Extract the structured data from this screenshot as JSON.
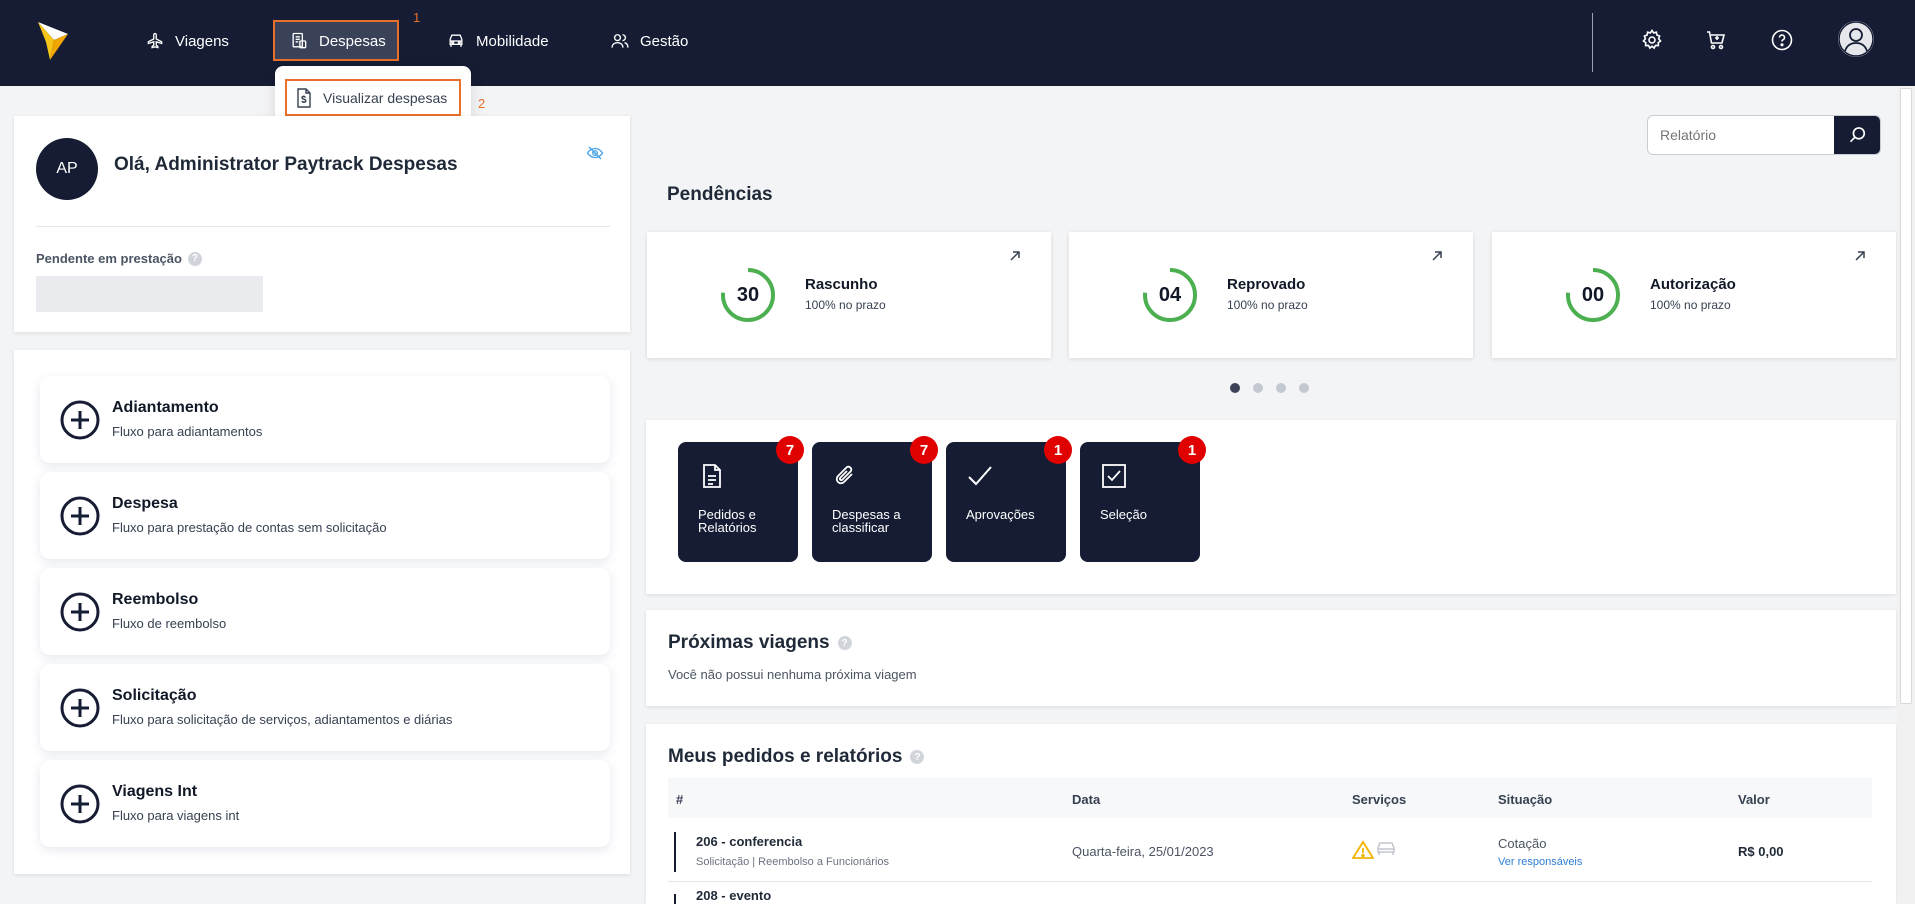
{
  "nav": {
    "items": [
      {
        "label": "Viagens",
        "icon": "airplane-icon"
      },
      {
        "label": "Despesas",
        "icon": "receipt-icon"
      },
      {
        "label": "Mobilidade",
        "icon": "car-icon"
      },
      {
        "label": "Gestão",
        "icon": "users-icon"
      }
    ],
    "step1": "1",
    "step2": "2",
    "right_icons": [
      "gear-icon",
      "cart-icon",
      "help-icon",
      "user-avatar-icon"
    ]
  },
  "dropdown": {
    "item": "Visualizar despesas",
    "icon": "dollar-document-icon"
  },
  "profile": {
    "initials": "AP",
    "greeting": "Olá, Administrator Paytrack Despesas",
    "pending_label": "Pendente em prestação",
    "help": "?"
  },
  "flows": [
    {
      "title": "Adiantamento",
      "subtitle": "Fluxo para adiantamentos"
    },
    {
      "title": "Despesa",
      "subtitle": "Fluxo para prestação de contas sem solicitação"
    },
    {
      "title": "Reembolso",
      "subtitle": "Fluxo de reembolso"
    },
    {
      "title": "Solicitação",
      "subtitle": "Fluxo para solicitação de serviços, adiantamentos e diárias"
    },
    {
      "title": "Viagens Int",
      "subtitle": "Fluxo para viagens int"
    }
  ],
  "search": {
    "placeholder": "Relatório"
  },
  "pendencias": {
    "title": "Pendências",
    "cards": [
      {
        "count": "30",
        "label": "Rascunho",
        "sub": "100% no prazo",
        "progress": 1.0
      },
      {
        "count": "04",
        "label": "Reprovado",
        "sub": "100% no prazo",
        "progress": 1.0
      },
      {
        "count": "00",
        "label": "Autorização",
        "sub": "100% no prazo",
        "progress": 1.0
      }
    ],
    "carousel": {
      "pages": 4,
      "active": 1
    }
  },
  "tiles": [
    {
      "label_line1": "Pedidos e",
      "label_line2": "Relatórios",
      "badge": "7",
      "icon": "document-icon"
    },
    {
      "label_line1": "Despesas a",
      "label_line2": "classificar",
      "badge": "7",
      "icon": "paperclip-icon"
    },
    {
      "label_line1": "Aprovações",
      "label_line2": "",
      "badge": "1",
      "icon": "checkmark-icon"
    },
    {
      "label_line1": "Seleção",
      "label_line2": "",
      "badge": "1",
      "icon": "checkbox-icon"
    }
  ],
  "trips": {
    "title": "Próximas viagens",
    "empty": "Você não possui nenhuma próxima viagem",
    "help": "?"
  },
  "orders": {
    "title": "Meus pedidos e relatórios",
    "help": "?",
    "columns": [
      "#",
      "Data",
      "Serviços",
      "Situação",
      "Valor"
    ],
    "rows": [
      {
        "title": "206 - conferencia",
        "sub": "Solicitação | Reembolso a Funcionários",
        "date": "Quarta-feira, 25/01/2023",
        "status": "Cotação",
        "link": "Ver responsáveis",
        "value": "R$ 0,00",
        "service_icons": [
          "warning-icon",
          "car-icon"
        ]
      },
      {
        "title": "208 - evento",
        "sub": "",
        "date": "",
        "status": "",
        "link": "",
        "value": ""
      }
    ]
  },
  "colors": {
    "navy": "#151c33",
    "accent": "#e86f2c",
    "ring": "#4caf50",
    "badge": "#e10000",
    "link": "#2f7fd8",
    "logo": "#f5c518"
  }
}
